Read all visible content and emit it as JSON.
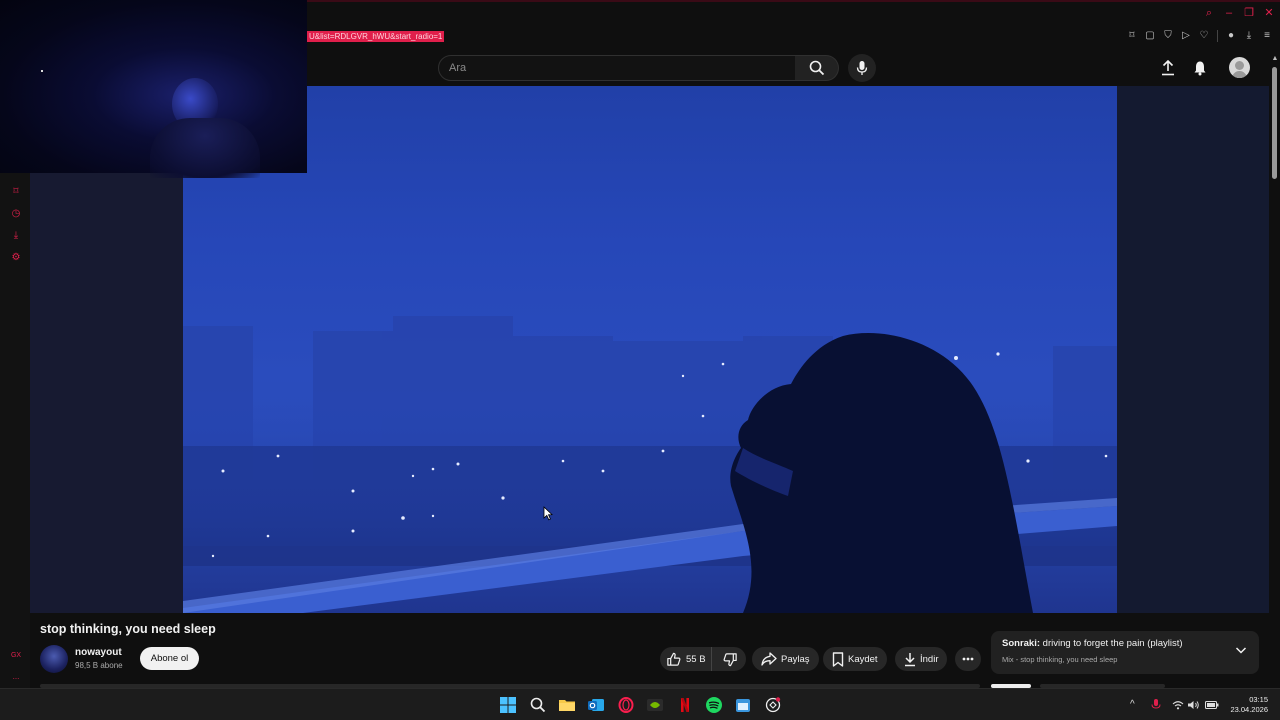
{
  "browser": {
    "url_highlight": "U&list=RDLGVR_hWU&start_radio=1",
    "window_controls": [
      "search-icon",
      "minimize-icon",
      "restore-icon",
      "close-icon"
    ],
    "extension_icons": [
      "pin-icon",
      "snapshot-icon",
      "shield-icon",
      "play-icon",
      "heart-icon",
      "profile-icon",
      "download-icon",
      "menu-icon"
    ]
  },
  "header": {
    "search_placeholder": "Ara",
    "icons": [
      "search-icon",
      "mic-icon",
      "upload-icon",
      "bell-icon",
      "avatar"
    ]
  },
  "sidebar": {
    "icons": [
      "pin-icon",
      "clock-icon",
      "download-icon",
      "settings-icon"
    ],
    "bottom_labels": [
      "GX",
      "..."
    ]
  },
  "video": {
    "title": "stop thinking, you need sleep",
    "channel": {
      "name": "nowayout",
      "subscribers": "98,5 B abone",
      "subscribe_label": "Abone ol"
    },
    "actions": {
      "likes": "55 B",
      "share": "Paylaş",
      "save": "Kaydet",
      "download": "İndir"
    }
  },
  "next_up": {
    "prefix": "Sonraki:",
    "title": "driving to forget the pain (playlist)",
    "subtitle": "Mix - stop thinking, you need sleep"
  },
  "taskbar": {
    "apps": [
      "windows-start-icon",
      "search-icon",
      "file-explorer-icon",
      "outlook-icon",
      "opera-gx-icon",
      "nvidia-icon",
      "netflix-icon",
      "spotify-icon",
      "calendar-icon",
      "chatgpt-icon"
    ],
    "tray": [
      "chevron-up-icon",
      "mic-icon",
      "wifi-icon",
      "volume-icon",
      "battery-icon"
    ],
    "time": "03:15",
    "date": "23.04.2026"
  },
  "colors": {
    "accent": "#e0204c",
    "background": "#0f0f0f",
    "video_blue": "#2a4cbd"
  }
}
